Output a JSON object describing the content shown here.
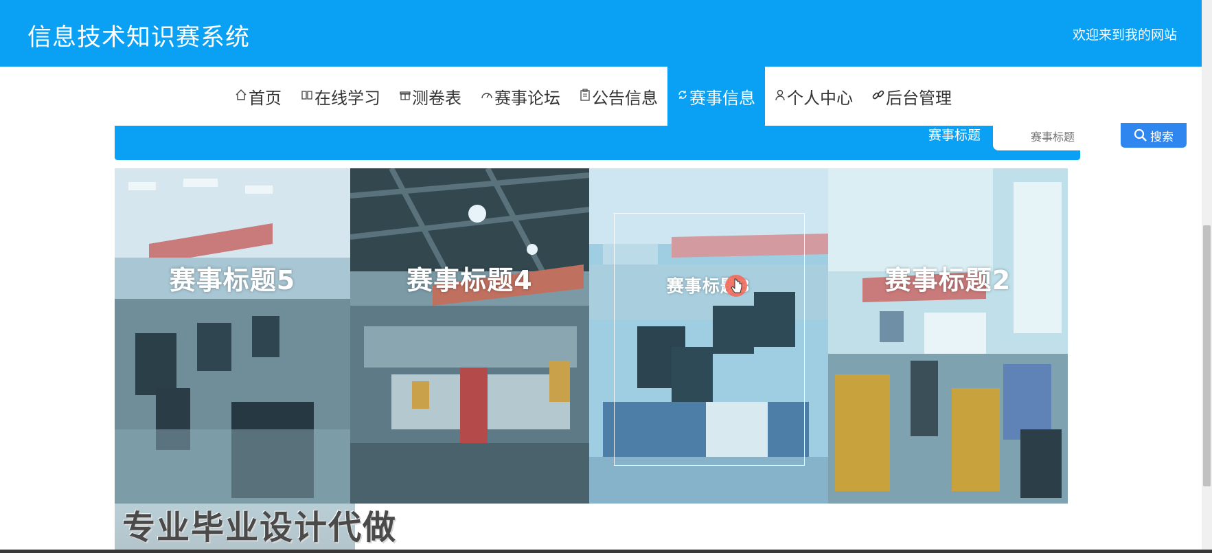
{
  "header": {
    "site_title": "信息技术知识赛系统",
    "welcome": "欢迎来到我的网站"
  },
  "nav": {
    "items": [
      {
        "label": "首页",
        "icon": "home-icon"
      },
      {
        "label": "在线学习",
        "icon": "book-icon"
      },
      {
        "label": "测卷表",
        "icon": "gift-icon"
      },
      {
        "label": "赛事论坛",
        "icon": "gauge-icon"
      },
      {
        "label": "公告信息",
        "icon": "clipboard-icon"
      },
      {
        "label": "赛事信息",
        "icon": "sync-icon",
        "active": true
      },
      {
        "label": "个人中心",
        "icon": "user-icon"
      },
      {
        "label": "后台管理",
        "icon": "link-icon"
      }
    ]
  },
  "search": {
    "label": "赛事标题",
    "placeholder": "赛事标题",
    "button_label": "搜索"
  },
  "cards": [
    {
      "title": "赛事标题5"
    },
    {
      "title": "赛事标题4"
    },
    {
      "title": "赛事标题3"
    },
    {
      "title": "赛事标题2"
    }
  ],
  "watermark": "专业毕业设计代做",
  "colors": {
    "primary": "#0aa1f5",
    "search_button": "#2f86ee",
    "photo_tint": "#8ec9e6"
  }
}
